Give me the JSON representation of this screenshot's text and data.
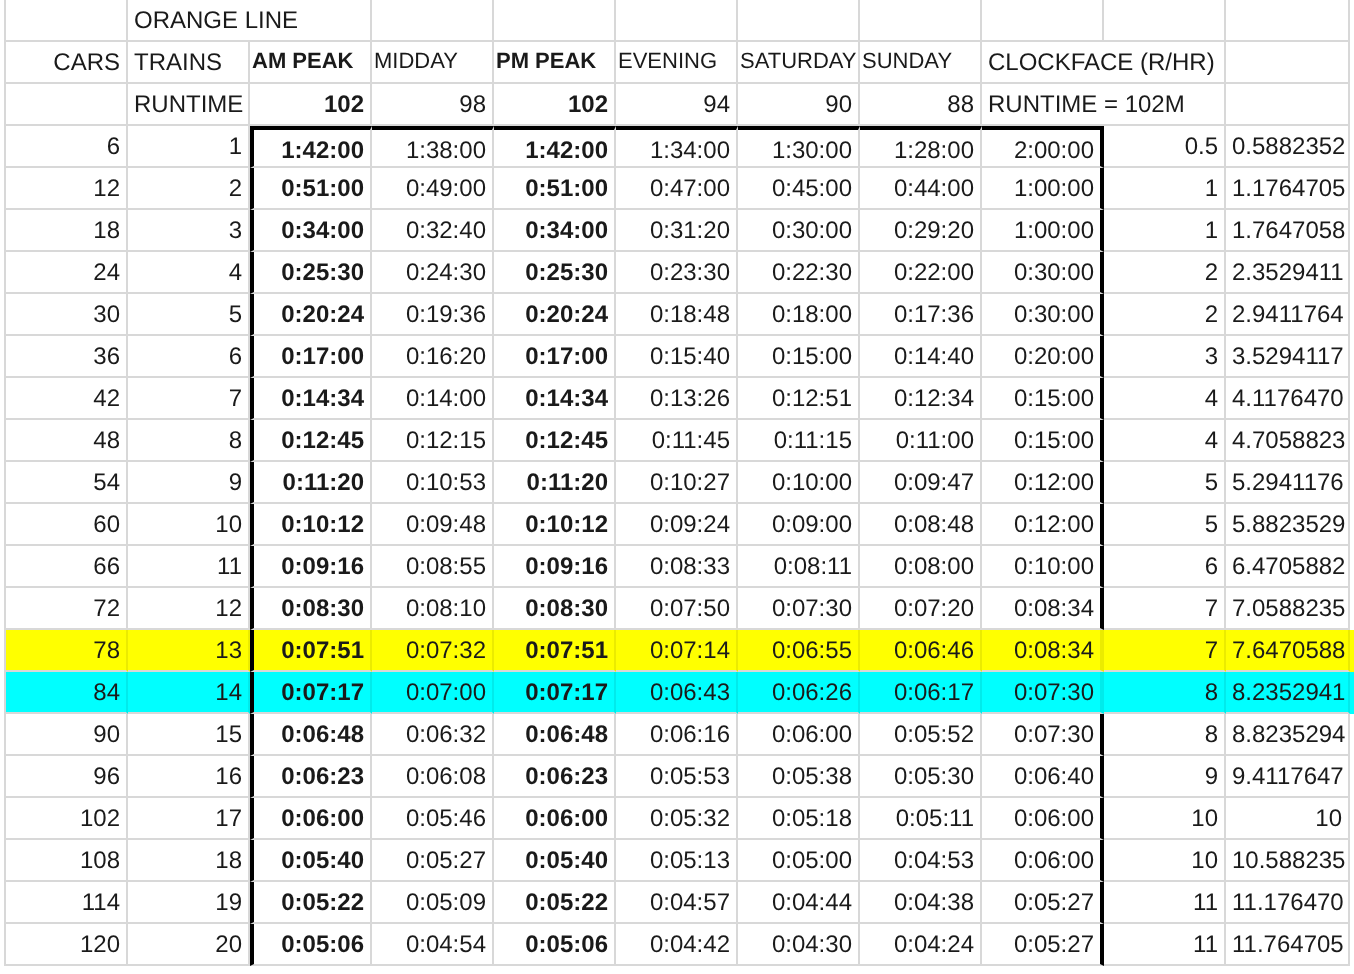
{
  "sheet": {
    "title": "ORANGE LINE",
    "header": {
      "cars": "CARS",
      "trains": "TRAINS",
      "runtime_label": "RUNTIME",
      "clockface": "CLOCKFACE (R/HR)",
      "clockface_runtime": "RUNTIME = 102M"
    },
    "columns": [
      {
        "label": "AM PEAK",
        "runtime": "102",
        "bold": true
      },
      {
        "label": "MIDDAY",
        "runtime": "98",
        "bold": false
      },
      {
        "label": "PM PEAK",
        "runtime": "102",
        "bold": true
      },
      {
        "label": "EVENING",
        "runtime": "94",
        "bold": false
      },
      {
        "label": "SATURDAY",
        "runtime": "90",
        "bold": false
      },
      {
        "label": "SUNDAY",
        "runtime": "88",
        "bold": false
      }
    ],
    "rows": [
      {
        "cars": "6",
        "trains": "1",
        "times": [
          "1:42:00",
          "1:38:00",
          "1:42:00",
          "1:34:00",
          "1:30:00",
          "1:28:00"
        ],
        "clockface": "2:00:00",
        "column_10": "0.5",
        "column_11": "0.5882352",
        "color": "#ffffff"
      },
      {
        "cars": "12",
        "trains": "2",
        "times": [
          "0:51:00",
          "0:49:00",
          "0:51:00",
          "0:47:00",
          "0:45:00",
          "0:44:00"
        ],
        "clockface": "1:00:00",
        "column_10": "1",
        "column_11": "1.1764705",
        "color": "#ffffff"
      },
      {
        "cars": "18",
        "trains": "3",
        "times": [
          "0:34:00",
          "0:32:40",
          "0:34:00",
          "0:31:20",
          "0:30:00",
          "0:29:20"
        ],
        "clockface": "1:00:00",
        "column_10": "1",
        "column_11": "1.7647058",
        "color": "#ffffff"
      },
      {
        "cars": "24",
        "trains": "4",
        "times": [
          "0:25:30",
          "0:24:30",
          "0:25:30",
          "0:23:30",
          "0:22:30",
          "0:22:00"
        ],
        "clockface": "0:30:00",
        "column_10": "2",
        "column_11": "2.3529411",
        "color": "#ffffff"
      },
      {
        "cars": "30",
        "trains": "5",
        "times": [
          "0:20:24",
          "0:19:36",
          "0:20:24",
          "0:18:48",
          "0:18:00",
          "0:17:36"
        ],
        "clockface": "0:30:00",
        "column_10": "2",
        "column_11": "2.9411764",
        "color": "#ffffff"
      },
      {
        "cars": "36",
        "trains": "6",
        "times": [
          "0:17:00",
          "0:16:20",
          "0:17:00",
          "0:15:40",
          "0:15:00",
          "0:14:40"
        ],
        "clockface": "0:20:00",
        "column_10": "3",
        "column_11": "3.5294117",
        "color": "#ffffff"
      },
      {
        "cars": "42",
        "trains": "7",
        "times": [
          "0:14:34",
          "0:14:00",
          "0:14:34",
          "0:13:26",
          "0:12:51",
          "0:12:34"
        ],
        "clockface": "0:15:00",
        "column_10": "4",
        "column_11": "4.1176470",
        "color": "#ffffff"
      },
      {
        "cars": "48",
        "trains": "8",
        "times": [
          "0:12:45",
          "0:12:15",
          "0:12:45",
          "0:11:45",
          "0:11:15",
          "0:11:00"
        ],
        "clockface": "0:15:00",
        "column_10": "4",
        "column_11": "4.7058823",
        "color": "#ffffff"
      },
      {
        "cars": "54",
        "trains": "9",
        "times": [
          "0:11:20",
          "0:10:53",
          "0:11:20",
          "0:10:27",
          "0:10:00",
          "0:09:47"
        ],
        "clockface": "0:12:00",
        "column_10": "5",
        "column_11": "5.2941176",
        "color": "#ffffff"
      },
      {
        "cars": "60",
        "trains": "10",
        "times": [
          "0:10:12",
          "0:09:48",
          "0:10:12",
          "0:09:24",
          "0:09:00",
          "0:08:48"
        ],
        "clockface": "0:12:00",
        "column_10": "5",
        "column_11": "5.8823529",
        "color": "#ffffff"
      },
      {
        "cars": "66",
        "trains": "11",
        "times": [
          "0:09:16",
          "0:08:55",
          "0:09:16",
          "0:08:33",
          "0:08:11",
          "0:08:00"
        ],
        "clockface": "0:10:00",
        "column_10": "6",
        "column_11": "6.4705882",
        "color": "#ffffff"
      },
      {
        "cars": "72",
        "trains": "12",
        "times": [
          "0:08:30",
          "0:08:10",
          "0:08:30",
          "0:07:50",
          "0:07:30",
          "0:07:20"
        ],
        "clockface": "0:08:34",
        "column_10": "7",
        "column_11": "7.0588235",
        "color": "#ffffff"
      },
      {
        "cars": "78",
        "trains": "13",
        "times": [
          "0:07:51",
          "0:07:32",
          "0:07:51",
          "0:07:14",
          "0:06:55",
          "0:06:46"
        ],
        "clockface": "0:08:34",
        "column_10": "7",
        "column_11": "7.6470588",
        "color": "#ffff00"
      },
      {
        "cars": "84",
        "trains": "14",
        "times": [
          "0:07:17",
          "0:07:00",
          "0:07:17",
          "0:06:43",
          "0:06:26",
          "0:06:17"
        ],
        "clockface": "0:07:30",
        "column_10": "8",
        "column_11": "8.2352941",
        "color": "#00ffff"
      },
      {
        "cars": "90",
        "trains": "15",
        "times": [
          "0:06:48",
          "0:06:32",
          "0:06:48",
          "0:06:16",
          "0:06:00",
          "0:05:52"
        ],
        "clockface": "0:07:30",
        "column_10": "8",
        "column_11": "8.8235294",
        "color": "#ffffff"
      },
      {
        "cars": "96",
        "trains": "16",
        "times": [
          "0:06:23",
          "0:06:08",
          "0:06:23",
          "0:05:53",
          "0:05:38",
          "0:05:30"
        ],
        "clockface": "0:06:40",
        "column_10": "9",
        "column_11": "9.4117647",
        "color": "#ffffff"
      },
      {
        "cars": "102",
        "trains": "17",
        "times": [
          "0:06:00",
          "0:05:46",
          "0:06:00",
          "0:05:32",
          "0:05:18",
          "0:05:11"
        ],
        "clockface": "0:06:00",
        "column_10": "10",
        "column_11": "10",
        "color": "#ffffff"
      },
      {
        "cars": "108",
        "trains": "18",
        "times": [
          "0:05:40",
          "0:05:27",
          "0:05:40",
          "0:05:13",
          "0:05:00",
          "0:04:53"
        ],
        "clockface": "0:06:00",
        "column_10": "10",
        "column_11": "10.588235",
        "color": "#ffffff"
      },
      {
        "cars": "114",
        "trains": "19",
        "times": [
          "0:05:22",
          "0:05:09",
          "0:05:22",
          "0:04:57",
          "0:04:44",
          "0:04:38"
        ],
        "clockface": "0:05:27",
        "column_10": "11",
        "column_11": "11.176470",
        "color": "#ffffff"
      },
      {
        "cars": "120",
        "trains": "20",
        "times": [
          "0:05:06",
          "0:04:54",
          "0:05:06",
          "0:04:42",
          "0:04:30",
          "0:04:24"
        ],
        "clockface": "0:05:27",
        "column_10": "11",
        "column_11": "11.764705",
        "color": "#ffffff"
      }
    ]
  }
}
